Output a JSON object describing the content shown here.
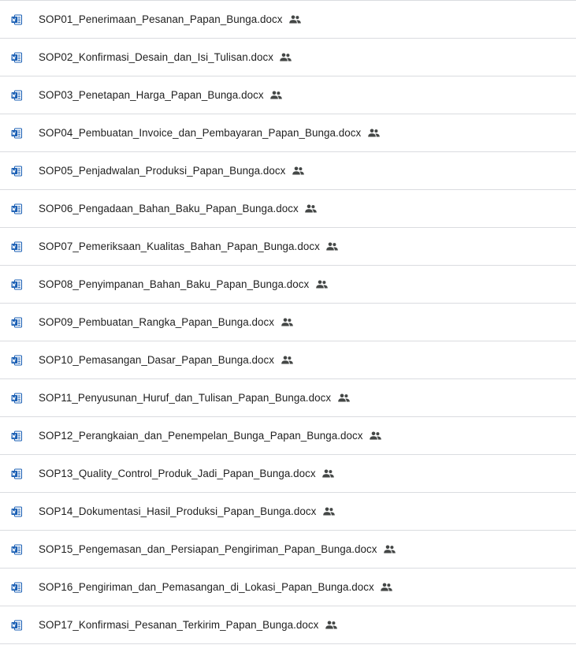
{
  "files": [
    {
      "name": "SOP01_Penerimaan_Pesanan_Papan_Bunga.docx",
      "icon": "word-doc-icon",
      "shared": true
    },
    {
      "name": "SOP02_Konfirmasi_Desain_dan_Isi_Tulisan.docx",
      "icon": "word-doc-icon",
      "shared": true
    },
    {
      "name": "SOP03_Penetapan_Harga_Papan_Bunga.docx",
      "icon": "word-doc-icon",
      "shared": true
    },
    {
      "name": "SOP04_Pembuatan_Invoice_dan_Pembayaran_Papan_Bunga.docx",
      "icon": "word-doc-icon",
      "shared": true
    },
    {
      "name": "SOP05_Penjadwalan_Produksi_Papan_Bunga.docx",
      "icon": "word-doc-icon",
      "shared": true
    },
    {
      "name": "SOP06_Pengadaan_Bahan_Baku_Papan_Bunga.docx",
      "icon": "word-doc-icon",
      "shared": true
    },
    {
      "name": "SOP07_Pemeriksaan_Kualitas_Bahan_Papan_Bunga.docx",
      "icon": "word-doc-icon",
      "shared": true
    },
    {
      "name": "SOP08_Penyimpanan_Bahan_Baku_Papan_Bunga.docx",
      "icon": "word-doc-icon",
      "shared": true
    },
    {
      "name": "SOP09_Pembuatan_Rangka_Papan_Bunga.docx",
      "icon": "word-doc-icon",
      "shared": true
    },
    {
      "name": "SOP10_Pemasangan_Dasar_Papan_Bunga.docx",
      "icon": "word-doc-icon",
      "shared": true
    },
    {
      "name": "SOP11_Penyusunan_Huruf_dan_Tulisan_Papan_Bunga.docx",
      "icon": "word-doc-icon",
      "shared": true
    },
    {
      "name": "SOP12_Perangkaian_dan_Penempelan_Bunga_Papan_Bunga.docx",
      "icon": "word-doc-icon",
      "shared": true
    },
    {
      "name": "SOP13_Quality_Control_Produk_Jadi_Papan_Bunga.docx",
      "icon": "word-doc-icon",
      "shared": true
    },
    {
      "name": "SOP14_Dokumentasi_Hasil_Produksi_Papan_Bunga.docx",
      "icon": "word-doc-icon",
      "shared": true
    },
    {
      "name": "SOP15_Pengemasan_dan_Persiapan_Pengiriman_Papan_Bunga.docx",
      "icon": "word-doc-icon",
      "shared": true
    },
    {
      "name": "SOP16_Pengiriman_dan_Pemasangan_di_Lokasi_Papan_Bunga.docx",
      "icon": "word-doc-icon",
      "shared": true
    },
    {
      "name": "SOP17_Konfirmasi_Pesanan_Terkirim_Papan_Bunga.docx",
      "icon": "word-doc-icon",
      "shared": true
    }
  ],
  "colors": {
    "word_blue": "#1a5fb4",
    "divider": "#dadce0",
    "text": "#1f1f1f",
    "shared_icon": "#444746"
  }
}
